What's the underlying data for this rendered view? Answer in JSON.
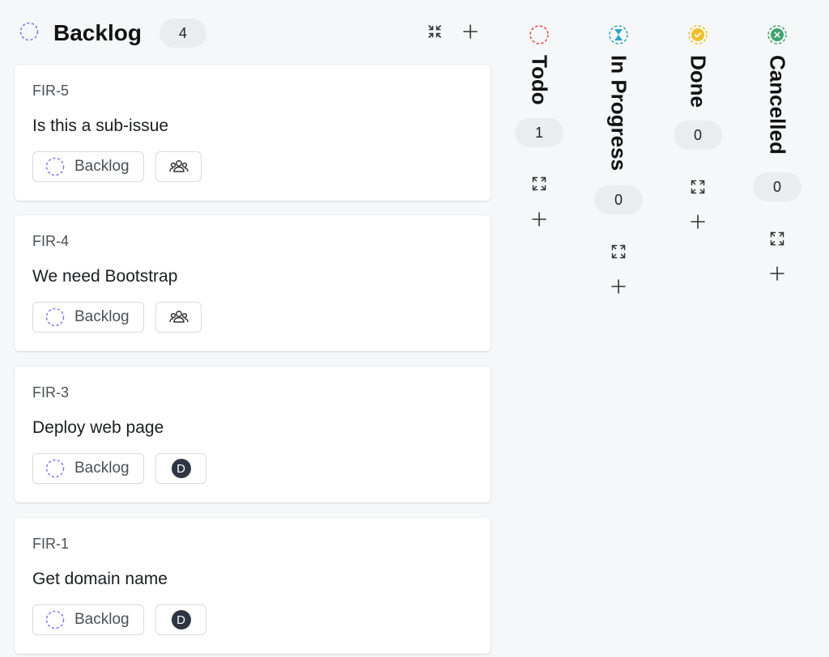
{
  "backlog": {
    "title": "Backlog",
    "count": "4",
    "cards": [
      {
        "id": "FIR-5",
        "title": "Is this a sub-issue",
        "status": "Backlog",
        "assignee": "team"
      },
      {
        "id": "FIR-4",
        "title": "We need Bootstrap",
        "status": "Backlog",
        "assignee": "team"
      },
      {
        "id": "FIR-3",
        "title": "Deploy web page",
        "status": "Backlog",
        "assignee": "D"
      },
      {
        "id": "FIR-1",
        "title": "Get domain name",
        "status": "Backlog",
        "assignee": "D"
      }
    ]
  },
  "columns": [
    {
      "title": "Todo",
      "count": "1",
      "color": "#e5484d"
    },
    {
      "title": "In Progress",
      "count": "0",
      "color": "#2aa6c8"
    },
    {
      "title": "Done",
      "count": "0",
      "color": "#f0c02f"
    },
    {
      "title": "Cancelled",
      "count": "0",
      "color": "#3fa36b"
    }
  ],
  "colors": {
    "backlog_status": "#7b7ff0",
    "background": "#f6f7f8",
    "avatar_bg": "#2f3542"
  },
  "icons": {
    "collapse": "collapse-icon",
    "expand": "expand-icon",
    "add": "plus-icon",
    "team": "team-icon"
  }
}
